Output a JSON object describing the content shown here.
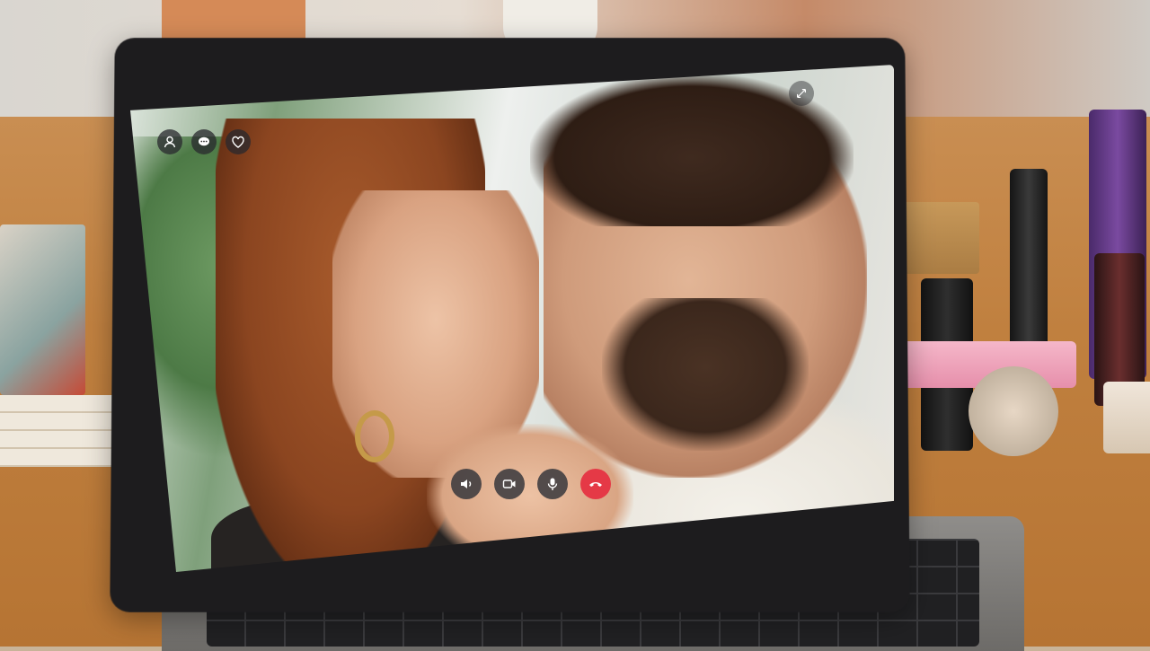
{
  "scene": {
    "description_free": true
  },
  "video_call": {
    "top_controls": [
      {
        "icon": "user-icon"
      },
      {
        "icon": "chat-icon"
      },
      {
        "icon": "heart-icon"
      }
    ],
    "expand_icon": "expand-icon",
    "call_controls": [
      {
        "icon": "speaker-icon"
      },
      {
        "icon": "video-camera-icon"
      },
      {
        "icon": "microphone-icon"
      },
      {
        "icon": "end-call-icon",
        "color": "#e53946"
      }
    ]
  }
}
